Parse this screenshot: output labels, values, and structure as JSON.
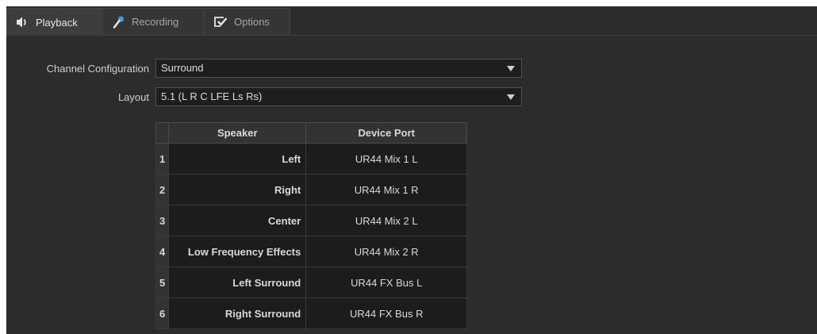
{
  "tabs": [
    {
      "label": "Playback",
      "icon": "speaker-icon",
      "active": true
    },
    {
      "label": "Recording",
      "icon": "microphone-icon",
      "active": false
    },
    {
      "label": "Options",
      "icon": "checkbox-options-icon",
      "active": false
    }
  ],
  "form": {
    "channel_config_label": "Channel Configuration",
    "channel_config_value": "Surround",
    "layout_label": "Layout",
    "layout_value": "5.1 (L R C LFE Ls Rs)"
  },
  "table": {
    "headers": [
      "Speaker",
      "Device Port"
    ],
    "rows": [
      {
        "index": "1",
        "speaker": "Left",
        "port": "UR44 Mix 1 L"
      },
      {
        "index": "2",
        "speaker": "Right",
        "port": "UR44 Mix 1 R"
      },
      {
        "index": "3",
        "speaker": "Center",
        "port": "UR44 Mix 2 L"
      },
      {
        "index": "4",
        "speaker": "Low Frequency Effects",
        "port": "UR44 Mix 2 R"
      },
      {
        "index": "5",
        "speaker": "Left Surround",
        "port": "UR44 FX Bus L"
      },
      {
        "index": "6",
        "speaker": "Right Surround",
        "port": "UR44 FX Bus R"
      }
    ]
  },
  "colors": {
    "panel_bg": "#2c2c2c",
    "field_bg": "#1e1e1e",
    "mic_accent": "#3a9fe0"
  }
}
